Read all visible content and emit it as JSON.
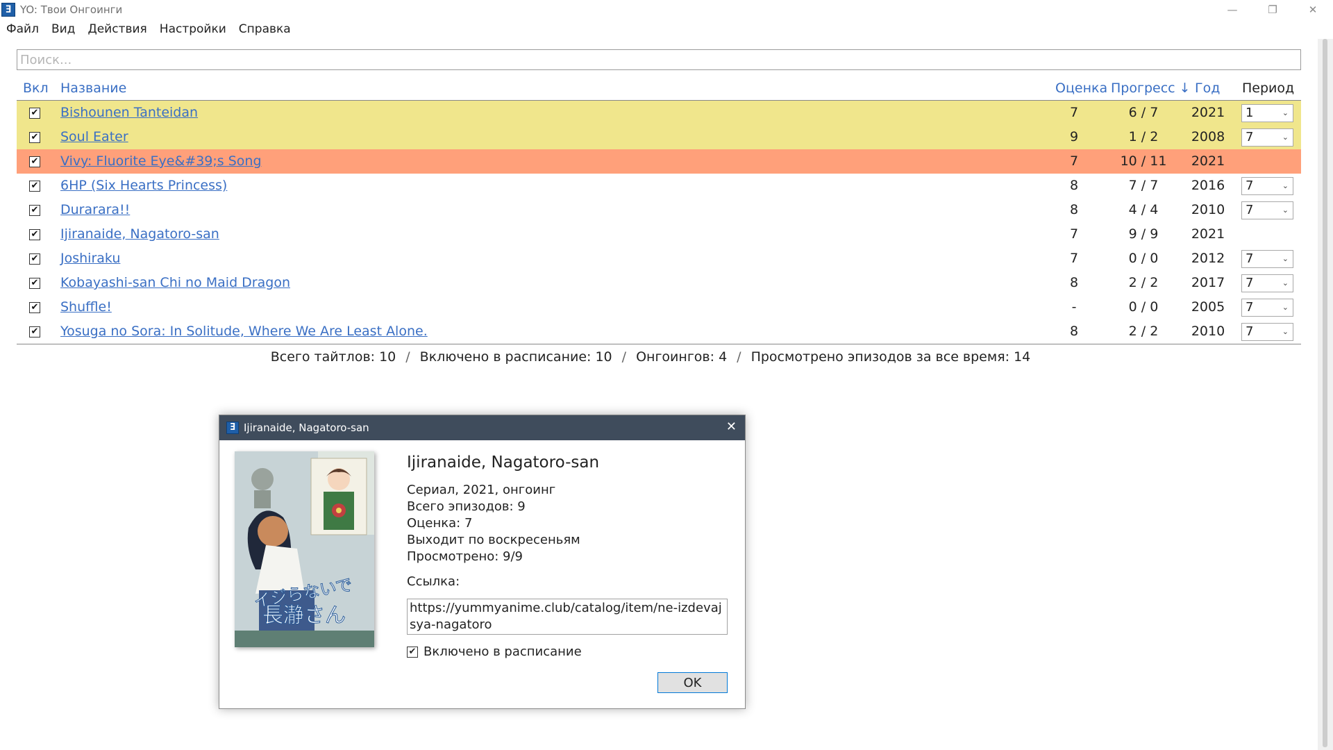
{
  "window": {
    "title": "YO: Твои Онгоинги",
    "app_icon_glyph": "Ǝ"
  },
  "window_controls": {
    "minimize": "—",
    "restore": "❐",
    "close": "✕"
  },
  "menu": [
    "Файл",
    "Вид",
    "Действия",
    "Настройки",
    "Справка"
  ],
  "search": {
    "placeholder": "Поиск...",
    "value": ""
  },
  "table": {
    "headers": {
      "enabled": "Вкл",
      "name": "Название",
      "score": "Оценка",
      "progress": "Прогресс ↓",
      "year": "Год",
      "period": "Период"
    },
    "rows": [
      {
        "checked": true,
        "name": "Bishounen Tanteidan",
        "score": "7",
        "progress": "6 / 7",
        "year": "2021",
        "period": "1",
        "highlight": "#f0e68c"
      },
      {
        "checked": true,
        "name": "Soul Eater",
        "score": "9",
        "progress": "1 / 2",
        "year": "2008",
        "period": "7",
        "highlight": "#f0e68c"
      },
      {
        "checked": true,
        "name": "Vivy: Fluorite Eye&#39;s Song",
        "score": "7",
        "progress": "10 / 11",
        "year": "2021",
        "period": null,
        "highlight": "#ffa07a"
      },
      {
        "checked": true,
        "name": "6HP (Six Hearts Princess)",
        "score": "8",
        "progress": "7 / 7",
        "year": "2016",
        "period": "7",
        "highlight": null
      },
      {
        "checked": true,
        "name": "Durarara!!",
        "score": "8",
        "progress": "4 / 4",
        "year": "2010",
        "period": "7",
        "highlight": null
      },
      {
        "checked": true,
        "name": "Ijiranaide, Nagatoro-san",
        "score": "7",
        "progress": "9 / 9",
        "year": "2021",
        "period": null,
        "highlight": null
      },
      {
        "checked": true,
        "name": "Joshiraku",
        "score": "7",
        "progress": "0 / 0",
        "year": "2012",
        "period": "7",
        "highlight": null
      },
      {
        "checked": true,
        "name": "Kobayashi-san Chi no Maid Dragon",
        "score": "8",
        "progress": "2 / 2",
        "year": "2017",
        "period": "7",
        "highlight": null
      },
      {
        "checked": true,
        "name": "Shuffle!",
        "score": "-",
        "progress": "0 / 0",
        "year": "2005",
        "period": "7",
        "highlight": null
      },
      {
        "checked": true,
        "name": "Yosuga no Sora: In Solitude, Where We Are Least Alone.",
        "score": "8",
        "progress": "2 / 2",
        "year": "2010",
        "period": "7",
        "highlight": null
      }
    ]
  },
  "summary": {
    "total": "Всего тайтлов: 10",
    "scheduled": "Включено в расписание: 10",
    "ongoing": "Онгоингов: 4",
    "watched": "Просмотрено эпизодов за все время: 14",
    "separator": "/"
  },
  "dialog": {
    "title": "Ijiranaide, Nagatoro-san",
    "heading": "Ijiranaide, Nagatoro-san",
    "info": [
      "Сериал, 2021, онгоинг",
      "Всего эпизодов: 9",
      "Оценка: 7",
      "Выходит по воскресеньям",
      "Просмотрено: 9/9"
    ],
    "link_label": "Ссылка:",
    "link": "https://yummyanime.club/catalog/item/ne-izdevajsya-nagatoro",
    "schedule_checkbox": "Включено в расписание",
    "schedule_checked": true,
    "ok": "OK",
    "close": "✕",
    "poster_text": "イジらないで、長瀞さん"
  }
}
